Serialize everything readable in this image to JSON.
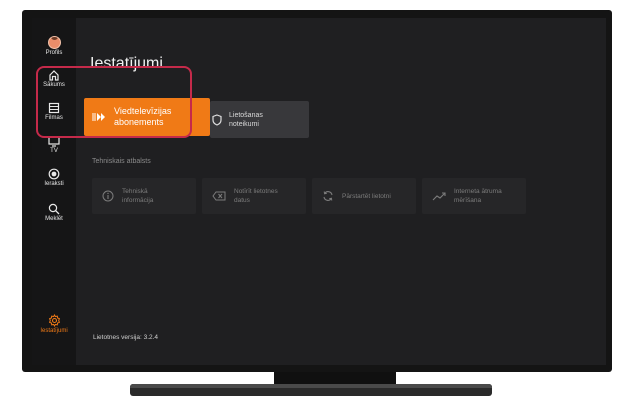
{
  "sidebar": {
    "items": [
      {
        "label": "Profils",
        "icon": "avatar"
      },
      {
        "label": "Sākums",
        "icon": "home-icon"
      },
      {
        "label": "Filmas",
        "icon": "film-icon"
      },
      {
        "label": "TV",
        "icon": "tv-icon"
      },
      {
        "label": "Ieraksti",
        "icon": "record-icon"
      },
      {
        "label": "Meklēt",
        "icon": "search-icon"
      }
    ],
    "settings": {
      "label": "Iestatījumi",
      "icon": "gear-icon"
    }
  },
  "main": {
    "title": "Iestatījumi",
    "tiles": [
      {
        "label": "Viedtelevīzijas abonements",
        "icon": "play-forward-icon",
        "selected": true
      },
      {
        "label": "Lietošanas noteikumi",
        "icon": "shield-icon",
        "selected": false
      }
    ],
    "support": {
      "section_label": "Tehniskais atbalsts",
      "tiles": [
        {
          "label": "Tehniskā informācija",
          "icon": "info-icon"
        },
        {
          "label": "Notīrīt lietotnes datus",
          "icon": "clear-icon"
        },
        {
          "label": "Pārstartēt lietotni",
          "icon": "refresh-icon"
        },
        {
          "label": "Interneta ātruma mērīšana",
          "icon": "trend-icon"
        }
      ]
    },
    "version": "Lietotnes versija: 3.2.4"
  },
  "colors": {
    "accent": "#f07a16",
    "highlight_outline": "#c52a4a",
    "screen_bg": "#1f1f21",
    "sidebar_bg": "#151516"
  }
}
